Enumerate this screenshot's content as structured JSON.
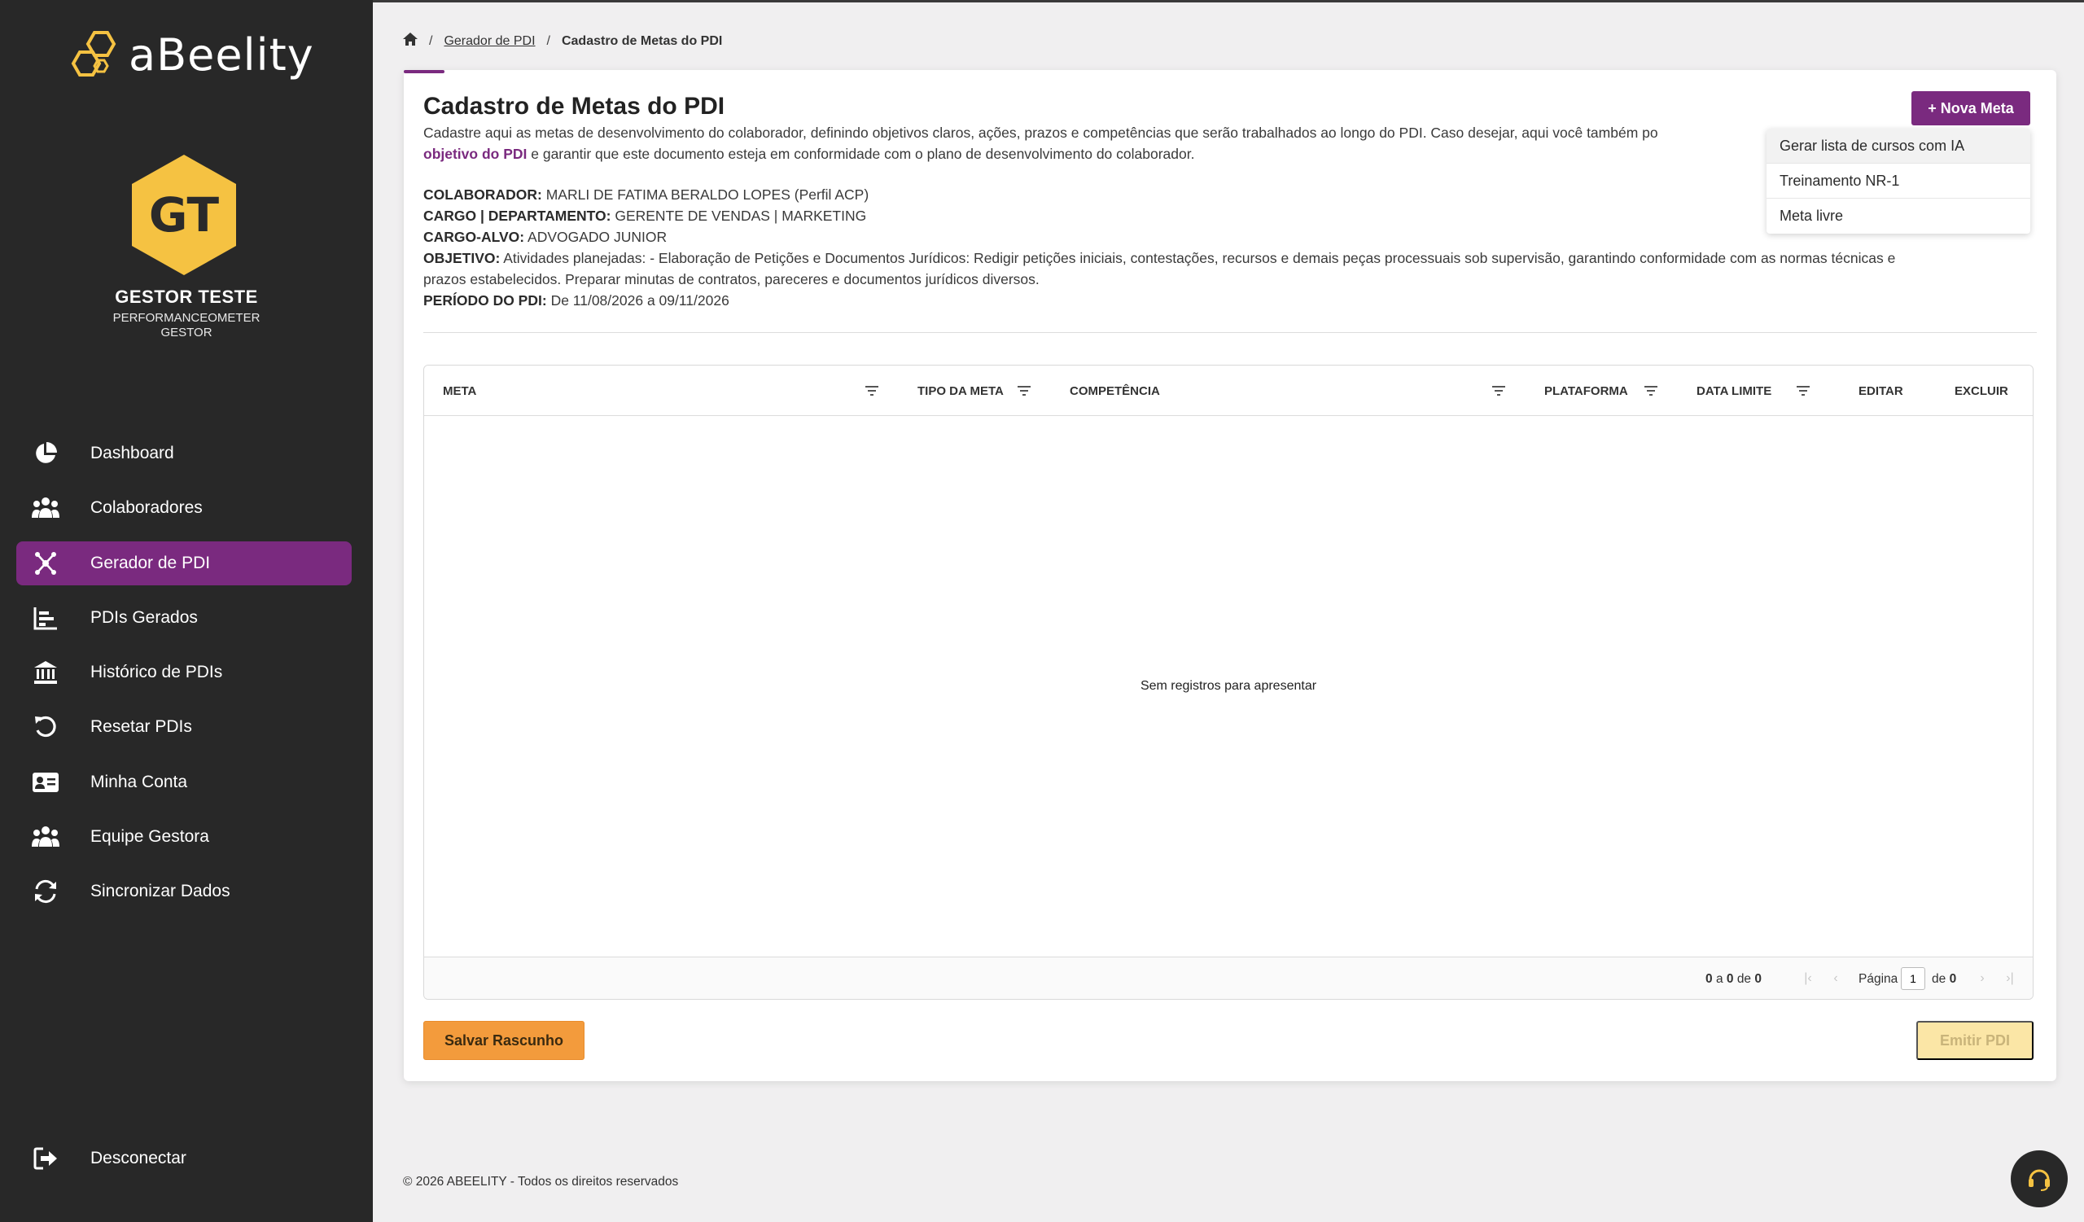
{
  "brand": {
    "logo_text": "aBeelity"
  },
  "profile": {
    "initials": "GT",
    "name": "GESTOR TESTE",
    "company": "PERFORMANCEOMETER",
    "role": "GESTOR"
  },
  "nav": {
    "items": [
      {
        "label": "Dashboard",
        "icon": "pie-chart-icon",
        "active": false
      },
      {
        "label": "Colaboradores",
        "icon": "users-icon",
        "active": false
      },
      {
        "label": "Gerador de PDI",
        "icon": "network-icon",
        "active": true
      },
      {
        "label": "PDIs Gerados",
        "icon": "bar-chart-icon",
        "active": false
      },
      {
        "label": "Histórico de PDIs",
        "icon": "bank-icon",
        "active": false
      },
      {
        "label": "Resetar PDIs",
        "icon": "reset-icon",
        "active": false
      },
      {
        "label": "Minha Conta",
        "icon": "id-card-icon",
        "active": false
      },
      {
        "label": "Equipe Gestora",
        "icon": "users-icon",
        "active": false
      },
      {
        "label": "Sincronizar Dados",
        "icon": "sync-icon",
        "active": false
      }
    ],
    "logout_label": "Desconectar"
  },
  "breadcrumb": {
    "parent": "Gerador de PDI",
    "current": "Cadastro de Metas do PDI"
  },
  "page": {
    "title": "Cadastro de Metas do PDI",
    "description_part1": "Cadastre aqui as metas de desenvolvimento do colaborador, definindo objetivos claros, ações, prazos e competências que serão trabalhados ao longo do PDI. Caso desejar, aqui você também po",
    "description_link": "objetivo do PDI",
    "description_part2": " e garantir que este documento esteja em conformidade com o plano de desenvolvimento do colaborador.",
    "new_button": "+ Nova Meta"
  },
  "dropdown": {
    "options": [
      "Gerar lista de cursos com IA",
      "Treinamento NR-1",
      "Meta livre"
    ]
  },
  "info": {
    "colaborador_label": "COLABORADOR:",
    "colaborador": "MARLI DE FATIMA BERALDO LOPES (Perfil ACP)",
    "cargo_label": "CARGO | DEPARTAMENTO:",
    "cargo": "GERENTE DE VENDAS | MARKETING",
    "cargo_alvo_label": "CARGO-ALVO:",
    "cargo_alvo": "ADVOGADO JUNIOR",
    "objetivo_label": "OBJETIVO:",
    "objetivo": "Atividades planejadas: - Elaboração de Petições e Documentos Jurídicos: Redigir petições iniciais, contestações, recursos e demais peças processuais sob supervisão, garantindo conformidade com as normas técnicas e prazos estabelecidos. Preparar minutas de contratos, pareceres e documentos jurídicos diversos.",
    "periodo_label": "PERÍODO DO PDI:",
    "periodo": "De 11/08/2026 a 09/11/2026"
  },
  "table": {
    "columns": [
      "META",
      "TIPO DA META",
      "COMPETÊNCIA",
      "PLATAFORMA",
      "DATA LIMITE",
      "EDITAR",
      "EXCLUIR"
    ],
    "empty_message": "Sem registros para apresentar",
    "pagination": {
      "from": "0",
      "a": "a",
      "to": "0",
      "de": "de",
      "total": "0",
      "page_label": "Página",
      "page": "1",
      "page_of": "de",
      "pages": "0"
    }
  },
  "actions": {
    "save": "Salvar Rascunho",
    "emit": "Emitir PDI"
  },
  "footer": {
    "copyright": "© 2026 ABEELITY - Todos os direitos reservados"
  },
  "colors": {
    "sidebar": "#282828",
    "accent": "#7a2a7f",
    "honey": "#f5c242",
    "save": "#f39b3c",
    "emit_disabled": "#fbe6a6"
  }
}
